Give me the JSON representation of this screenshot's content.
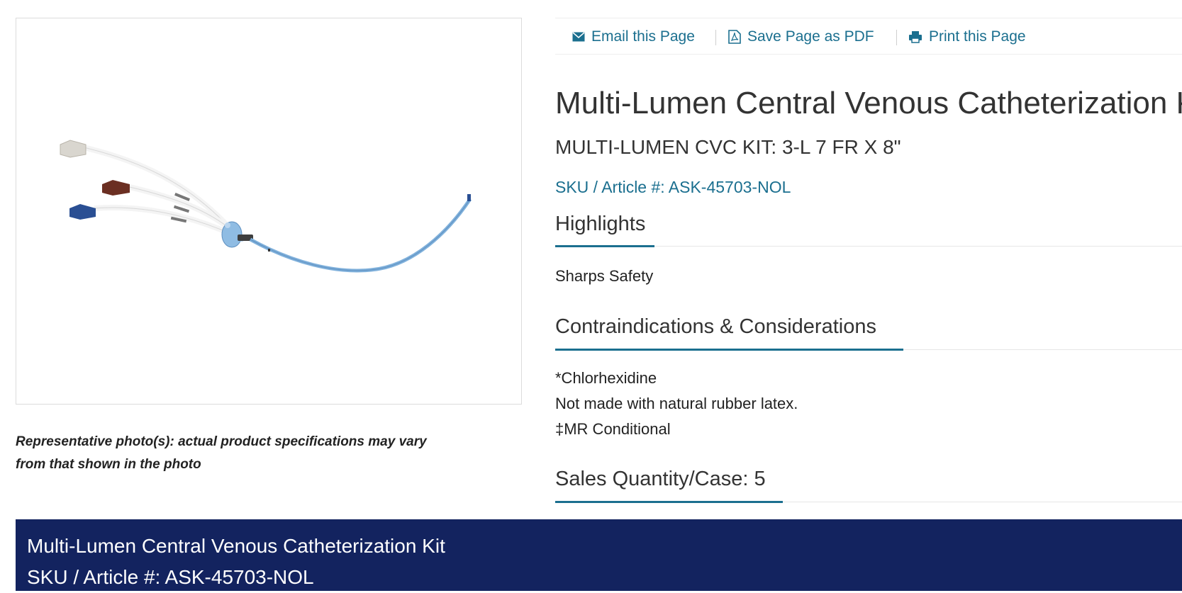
{
  "toolbar": {
    "email_label": "Email this Page",
    "pdf_label": "Save Page as PDF",
    "print_label": "Print this Page"
  },
  "product": {
    "title": "Multi-Lumen Central Venous Catheterization Kit",
    "subtitle": "MULTI-LUMEN CVC KIT: 3-L 7 FR X 8\"",
    "sku": "SKU / Article #: ASK-45703-NOL"
  },
  "photo": {
    "caption_line1": "Representative photo(s): actual product specifications may vary",
    "caption_line2": "from that shown in the photo"
  },
  "sections": {
    "highlights": {
      "heading": "Highlights",
      "items": [
        "Sharps Safety"
      ]
    },
    "contraindications": {
      "heading": "Contraindications & Considerations",
      "items": [
        "*Chlorhexidine",
        "Not made with natural rubber latex.",
        "‡MR Conditional"
      ]
    },
    "sales": {
      "heading": "Sales Quantity/Case: 5"
    }
  },
  "footer": {
    "title": "Multi-Lumen Central Venous Catheterization Kit",
    "sku": "SKU / Article #: ASK-45703-NOL"
  },
  "colors": {
    "link": "#1b6f8f",
    "footer_bg": "#13235f",
    "hub_gray": "#d9d6cf",
    "hub_brown": "#6b2f22",
    "hub_blue": "#2a4f93",
    "catheter_blue": "#7fb0db"
  },
  "icons": [
    "envelope-icon",
    "pdf-icon",
    "printer-icon"
  ]
}
